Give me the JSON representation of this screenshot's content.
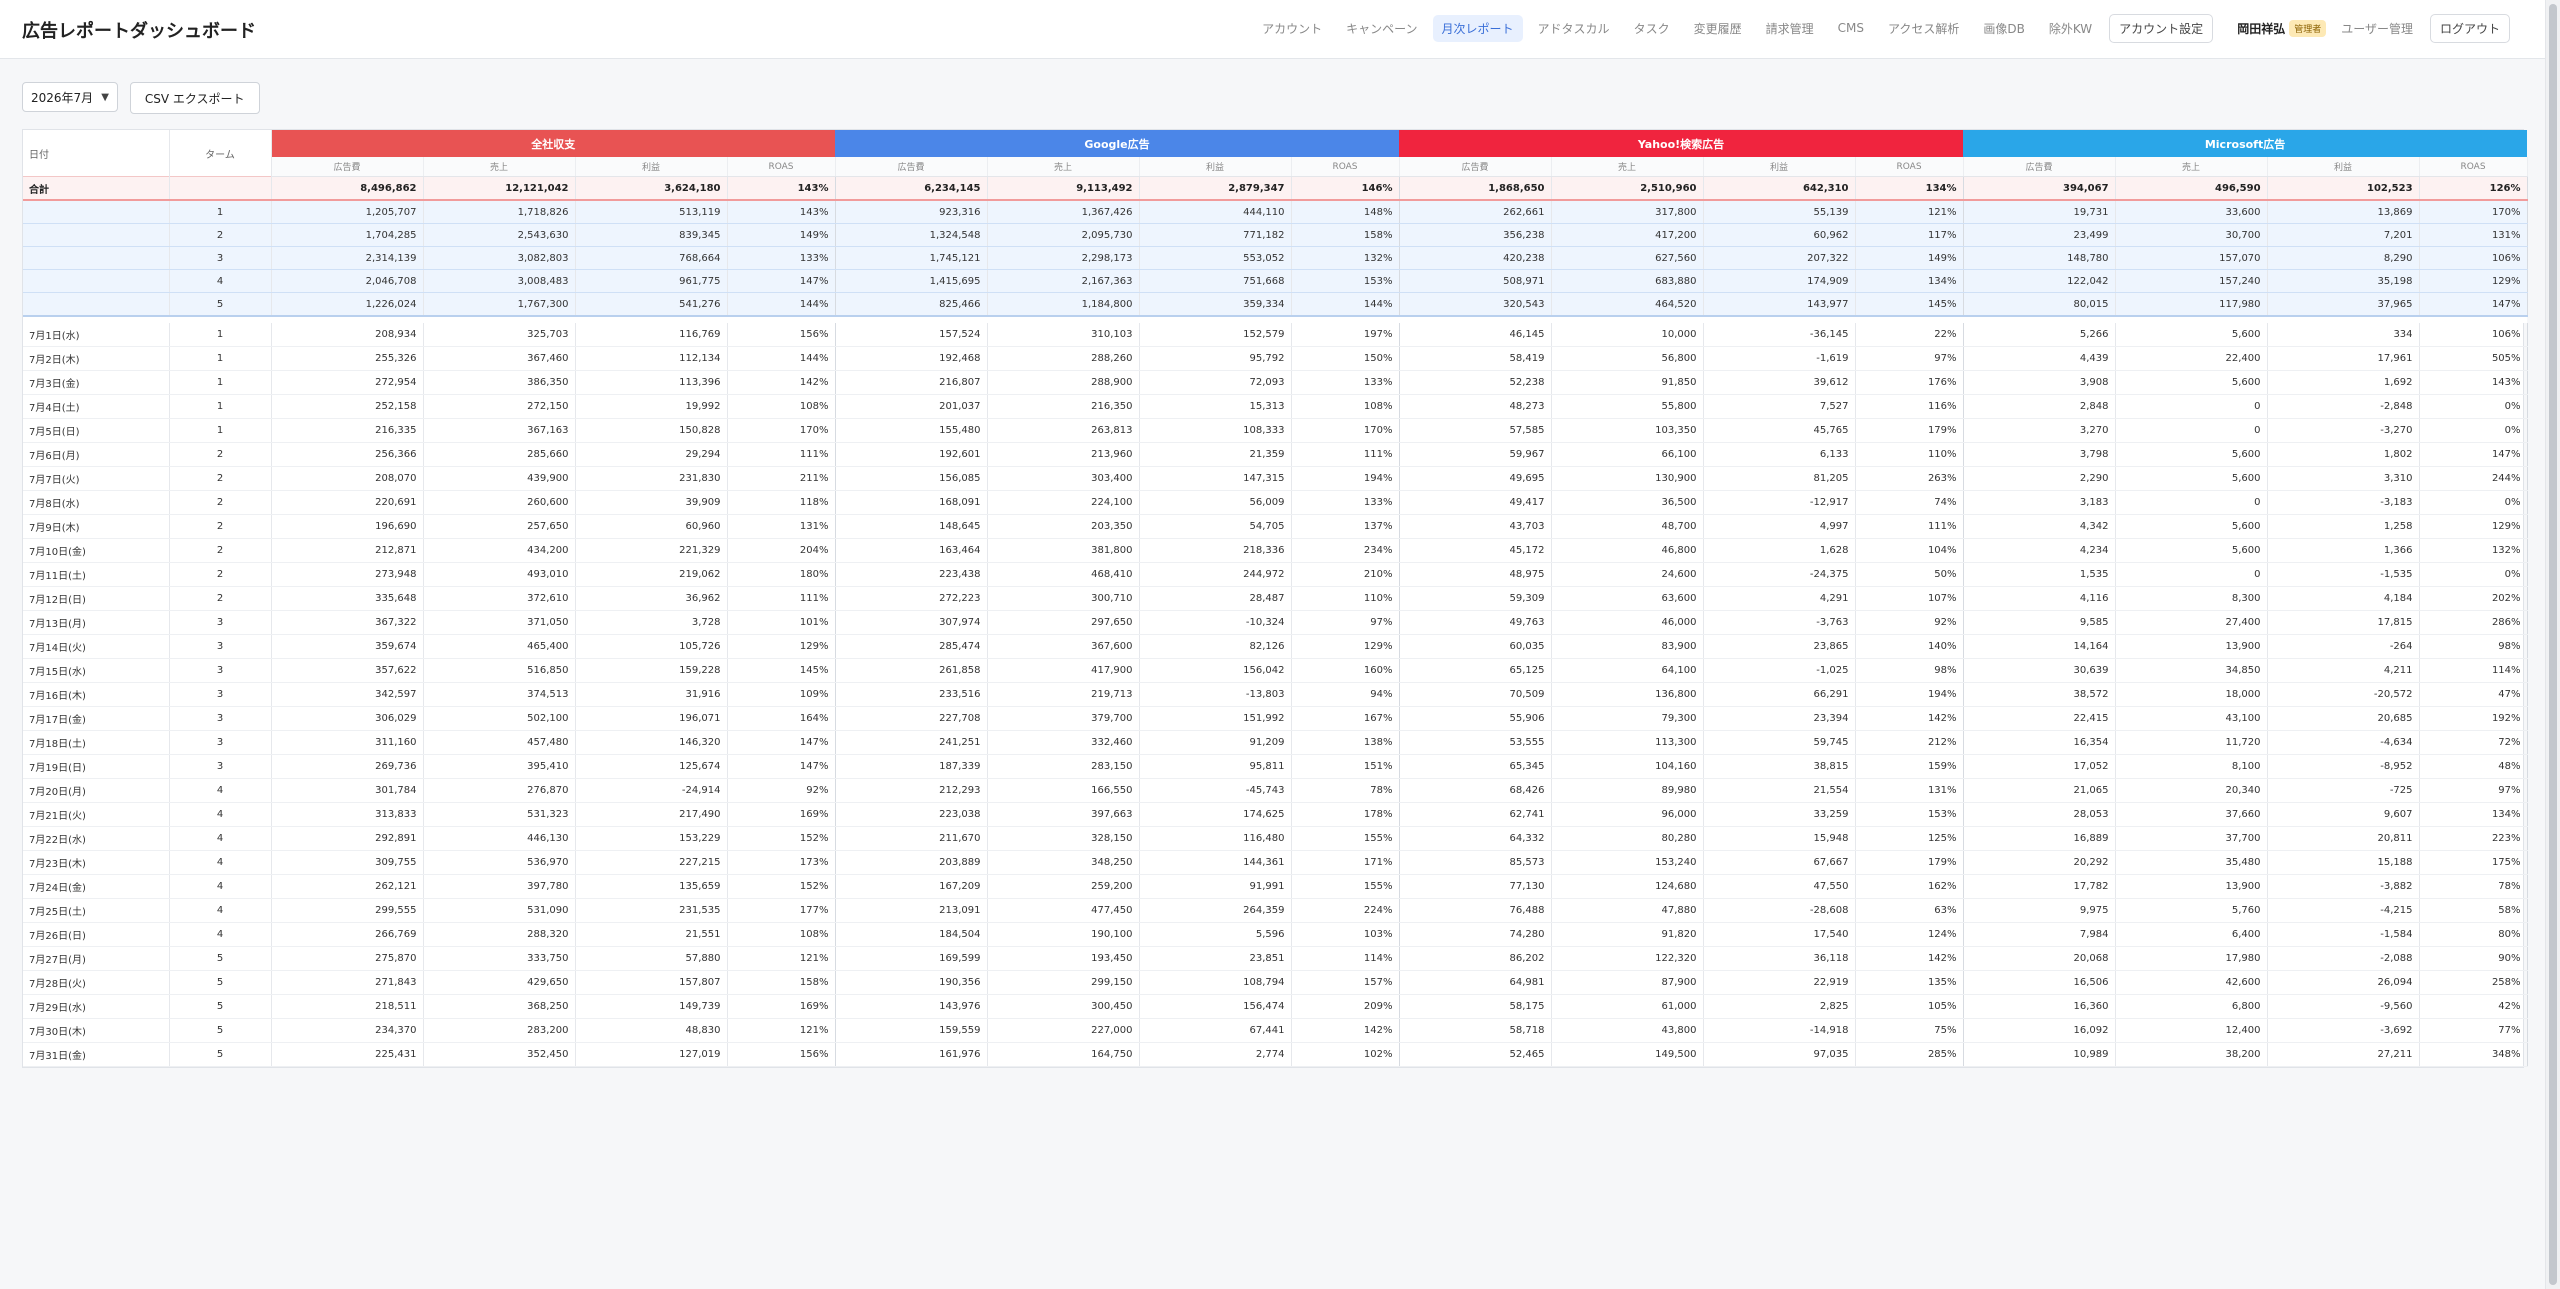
{
  "app": {
    "title": "広告レポートダッシュボード"
  },
  "nav": {
    "items": [
      "アカウント",
      "キャンペーン",
      "月次レポート",
      "アドタスカル",
      "タスク",
      "変更履歴",
      "請求管理",
      "CMS",
      "アクセス解析",
      "画像DB",
      "除外KW"
    ],
    "active": "月次レポート",
    "account_settings": "アカウント設定",
    "user_name": "岡田祥弘",
    "user_role": "管理者",
    "user_admin": "ユーザー管理",
    "logout": "ログアウト"
  },
  "toolbar": {
    "month": "2026年7月",
    "csv_label": "CSV エクスポート"
  },
  "table": {
    "date_header": "日付",
    "turn_header": "ターム",
    "groups": [
      "全社収支",
      "Google広告",
      "Yahoo!検索広告",
      "Microsoft広告"
    ],
    "metrics": [
      "広告費",
      "売上",
      "利益",
      "ROAS"
    ],
    "total": {
      "label": "合計",
      "cells": [
        "8,496,862",
        "12,121,042",
        "3,624,180",
        "143%",
        "6,234,145",
        "9,113,492",
        "2,879,347",
        "146%",
        "1,868,650",
        "2,510,960",
        "642,310",
        "134%",
        "394,067",
        "496,590",
        "102,523",
        "126%"
      ]
    },
    "turns": [
      {
        "turn": "1",
        "cells": [
          "1,205,707",
          "1,718,826",
          "513,119",
          "143%",
          "923,316",
          "1,367,426",
          "444,110",
          "148%",
          "262,661",
          "317,800",
          "55,139",
          "121%",
          "19,731",
          "33,600",
          "13,869",
          "170%"
        ]
      },
      {
        "turn": "2",
        "cells": [
          "1,704,285",
          "2,543,630",
          "839,345",
          "149%",
          "1,324,548",
          "2,095,730",
          "771,182",
          "158%",
          "356,238",
          "417,200",
          "60,962",
          "117%",
          "23,499",
          "30,700",
          "7,201",
          "131%"
        ]
      },
      {
        "turn": "3",
        "cells": [
          "2,314,139",
          "3,082,803",
          "768,664",
          "133%",
          "1,745,121",
          "2,298,173",
          "553,052",
          "132%",
          "420,238",
          "627,560",
          "207,322",
          "149%",
          "148,780",
          "157,070",
          "8,290",
          "106%"
        ]
      },
      {
        "turn": "4",
        "cells": [
          "2,046,708",
          "3,008,483",
          "961,775",
          "147%",
          "1,415,695",
          "2,167,363",
          "751,668",
          "153%",
          "508,971",
          "683,880",
          "174,909",
          "134%",
          "122,042",
          "157,240",
          "35,198",
          "129%"
        ]
      },
      {
        "turn": "5",
        "cells": [
          "1,226,024",
          "1,767,300",
          "541,276",
          "144%",
          "825,466",
          "1,184,800",
          "359,334",
          "144%",
          "320,543",
          "464,520",
          "143,977",
          "145%",
          "80,015",
          "117,980",
          "37,965",
          "147%"
        ]
      }
    ],
    "days": [
      {
        "date": "7月1日(水)",
        "wd": "",
        "turn": "1",
        "cells": [
          "208,934",
          "325,703",
          "116,769",
          "156%",
          "157,524",
          "310,103",
          "152,579",
          "197%",
          "46,145",
          "10,000",
          "-36,145",
          "22%",
          "5,266",
          "5,600",
          "334",
          "106%"
        ]
      },
      {
        "date": "7月2日(木)",
        "wd": "",
        "turn": "1",
        "cells": [
          "255,326",
          "367,460",
          "112,134",
          "144%",
          "192,468",
          "288,260",
          "95,792",
          "150%",
          "58,419",
          "56,800",
          "-1,619",
          "97%",
          "4,439",
          "22,400",
          "17,961",
          "505%"
        ]
      },
      {
        "date": "7月3日(金)",
        "wd": "",
        "turn": "1",
        "cells": [
          "272,954",
          "386,350",
          "113,396",
          "142%",
          "216,807",
          "288,900",
          "72,093",
          "133%",
          "52,238",
          "91,850",
          "39,612",
          "176%",
          "3,908",
          "5,600",
          "1,692",
          "143%"
        ]
      },
      {
        "date": "7月4日(土)",
        "wd": "sat",
        "turn": "1",
        "cells": [
          "252,158",
          "272,150",
          "19,992",
          "108%",
          "201,037",
          "216,350",
          "15,313",
          "108%",
          "48,273",
          "55,800",
          "7,527",
          "116%",
          "2,848",
          "0",
          "-2,848",
          "0%"
        ]
      },
      {
        "date": "7月5日(日)",
        "wd": "sun",
        "turn": "1",
        "cells": [
          "216,335",
          "367,163",
          "150,828",
          "170%",
          "155,480",
          "263,813",
          "108,333",
          "170%",
          "57,585",
          "103,350",
          "45,765",
          "179%",
          "3,270",
          "0",
          "-3,270",
          "0%"
        ]
      },
      {
        "date": "7月6日(月)",
        "wd": "",
        "turn": "2",
        "cells": [
          "256,366",
          "285,660",
          "29,294",
          "111%",
          "192,601",
          "213,960",
          "21,359",
          "111%",
          "59,967",
          "66,100",
          "6,133",
          "110%",
          "3,798",
          "5,600",
          "1,802",
          "147%"
        ]
      },
      {
        "date": "7月7日(火)",
        "wd": "",
        "turn": "2",
        "cells": [
          "208,070",
          "439,900",
          "231,830",
          "211%",
          "156,085",
          "303,400",
          "147,315",
          "194%",
          "49,695",
          "130,900",
          "81,205",
          "263%",
          "2,290",
          "5,600",
          "3,310",
          "244%"
        ]
      },
      {
        "date": "7月8日(水)",
        "wd": "",
        "turn": "2",
        "cells": [
          "220,691",
          "260,600",
          "39,909",
          "118%",
          "168,091",
          "224,100",
          "56,009",
          "133%",
          "49,417",
          "36,500",
          "-12,917",
          "74%",
          "3,183",
          "0",
          "-3,183",
          "0%"
        ]
      },
      {
        "date": "7月9日(木)",
        "wd": "",
        "turn": "2",
        "cells": [
          "196,690",
          "257,650",
          "60,960",
          "131%",
          "148,645",
          "203,350",
          "54,705",
          "137%",
          "43,703",
          "48,700",
          "4,997",
          "111%",
          "4,342",
          "5,600",
          "1,258",
          "129%"
        ]
      },
      {
        "date": "7月10日(金)",
        "wd": "",
        "turn": "2",
        "cells": [
          "212,871",
          "434,200",
          "221,329",
          "204%",
          "163,464",
          "381,800",
          "218,336",
          "234%",
          "45,172",
          "46,800",
          "1,628",
          "104%",
          "4,234",
          "5,600",
          "1,366",
          "132%"
        ]
      },
      {
        "date": "7月11日(土)",
        "wd": "sat",
        "turn": "2",
        "cells": [
          "273,948",
          "493,010",
          "219,062",
          "180%",
          "223,438",
          "468,410",
          "244,972",
          "210%",
          "48,975",
          "24,600",
          "-24,375",
          "50%",
          "1,535",
          "0",
          "-1,535",
          "0%"
        ]
      },
      {
        "date": "7月12日(日)",
        "wd": "sun",
        "turn": "2",
        "cells": [
          "335,648",
          "372,610",
          "36,962",
          "111%",
          "272,223",
          "300,710",
          "28,487",
          "110%",
          "59,309",
          "63,600",
          "4,291",
          "107%",
          "4,116",
          "8,300",
          "4,184",
          "202%"
        ]
      },
      {
        "date": "7月13日(月)",
        "wd": "",
        "turn": "3",
        "cells": [
          "367,322",
          "371,050",
          "3,728",
          "101%",
          "307,974",
          "297,650",
          "-10,324",
          "97%",
          "49,763",
          "46,000",
          "-3,763",
          "92%",
          "9,585",
          "27,400",
          "17,815",
          "286%"
        ]
      },
      {
        "date": "7月14日(火)",
        "wd": "",
        "turn": "3",
        "cells": [
          "359,674",
          "465,400",
          "105,726",
          "129%",
          "285,474",
          "367,600",
          "82,126",
          "129%",
          "60,035",
          "83,900",
          "23,865",
          "140%",
          "14,164",
          "13,900",
          "-264",
          "98%"
        ]
      },
      {
        "date": "7月15日(水)",
        "wd": "",
        "turn": "3",
        "cells": [
          "357,622",
          "516,850",
          "159,228",
          "145%",
          "261,858",
          "417,900",
          "156,042",
          "160%",
          "65,125",
          "64,100",
          "-1,025",
          "98%",
          "30,639",
          "34,850",
          "4,211",
          "114%"
        ]
      },
      {
        "date": "7月16日(木)",
        "wd": "",
        "turn": "3",
        "cells": [
          "342,597",
          "374,513",
          "31,916",
          "109%",
          "233,516",
          "219,713",
          "-13,803",
          "94%",
          "70,509",
          "136,800",
          "66,291",
          "194%",
          "38,572",
          "18,000",
          "-20,572",
          "47%"
        ]
      },
      {
        "date": "7月17日(金)",
        "wd": "",
        "turn": "3",
        "cells": [
          "306,029",
          "502,100",
          "196,071",
          "164%",
          "227,708",
          "379,700",
          "151,992",
          "167%",
          "55,906",
          "79,300",
          "23,394",
          "142%",
          "22,415",
          "43,100",
          "20,685",
          "192%"
        ]
      },
      {
        "date": "7月18日(土)",
        "wd": "sat",
        "turn": "3",
        "cells": [
          "311,160",
          "457,480",
          "146,320",
          "147%",
          "241,251",
          "332,460",
          "91,209",
          "138%",
          "53,555",
          "113,300",
          "59,745",
          "212%",
          "16,354",
          "11,720",
          "-4,634",
          "72%"
        ]
      },
      {
        "date": "7月19日(日)",
        "wd": "sun",
        "turn": "3",
        "cells": [
          "269,736",
          "395,410",
          "125,674",
          "147%",
          "187,339",
          "283,150",
          "95,811",
          "151%",
          "65,345",
          "104,160",
          "38,815",
          "159%",
          "17,052",
          "8,100",
          "-8,952",
          "48%"
        ]
      },
      {
        "date": "7月20日(月)",
        "wd": "sun",
        "turn": "4",
        "cells": [
          "301,784",
          "276,870",
          "-24,914",
          "92%",
          "212,293",
          "166,550",
          "-45,743",
          "78%",
          "68,426",
          "89,980",
          "21,554",
          "131%",
          "21,065",
          "20,340",
          "-725",
          "97%"
        ]
      },
      {
        "date": "7月21日(火)",
        "wd": "",
        "turn": "4",
        "cells": [
          "313,833",
          "531,323",
          "217,490",
          "169%",
          "223,038",
          "397,663",
          "174,625",
          "178%",
          "62,741",
          "96,000",
          "33,259",
          "153%",
          "28,053",
          "37,660",
          "9,607",
          "134%"
        ]
      },
      {
        "date": "7月22日(水)",
        "wd": "",
        "turn": "4",
        "cells": [
          "292,891",
          "446,130",
          "153,229",
          "152%",
          "211,670",
          "328,150",
          "116,480",
          "155%",
          "64,332",
          "80,280",
          "15,948",
          "125%",
          "16,889",
          "37,700",
          "20,811",
          "223%"
        ]
      },
      {
        "date": "7月23日(木)",
        "wd": "",
        "turn": "4",
        "cells": [
          "309,755",
          "536,970",
          "227,215",
          "173%",
          "203,889",
          "348,250",
          "144,361",
          "171%",
          "85,573",
          "153,240",
          "67,667",
          "179%",
          "20,292",
          "35,480",
          "15,188",
          "175%"
        ]
      },
      {
        "date": "7月24日(金)",
        "wd": "",
        "turn": "4",
        "cells": [
          "262,121",
          "397,780",
          "135,659",
          "152%",
          "167,209",
          "259,200",
          "91,991",
          "155%",
          "77,130",
          "124,680",
          "47,550",
          "162%",
          "17,782",
          "13,900",
          "-3,882",
          "78%"
        ]
      },
      {
        "date": "7月25日(土)",
        "wd": "sat",
        "turn": "4",
        "cells": [
          "299,555",
          "531,090",
          "231,535",
          "177%",
          "213,091",
          "477,450",
          "264,359",
          "224%",
          "76,488",
          "47,880",
          "-28,608",
          "63%",
          "9,975",
          "5,760",
          "-4,215",
          "58%"
        ]
      },
      {
        "date": "7月26日(日)",
        "wd": "sun",
        "turn": "4",
        "cells": [
          "266,769",
          "288,320",
          "21,551",
          "108%",
          "184,504",
          "190,100",
          "5,596",
          "103%",
          "74,280",
          "91,820",
          "17,540",
          "124%",
          "7,984",
          "6,400",
          "-1,584",
          "80%"
        ]
      },
      {
        "date": "7月27日(月)",
        "wd": "",
        "turn": "5",
        "cells": [
          "275,870",
          "333,750",
          "57,880",
          "121%",
          "169,599",
          "193,450",
          "23,851",
          "114%",
          "86,202",
          "122,320",
          "36,118",
          "142%",
          "20,068",
          "17,980",
          "-2,088",
          "90%"
        ]
      },
      {
        "date": "7月28日(火)",
        "wd": "",
        "turn": "5",
        "cells": [
          "271,843",
          "429,650",
          "157,807",
          "158%",
          "190,356",
          "299,150",
          "108,794",
          "157%",
          "64,981",
          "87,900",
          "22,919",
          "135%",
          "16,506",
          "42,600",
          "26,094",
          "258%"
        ]
      },
      {
        "date": "7月29日(水)",
        "wd": "",
        "turn": "5",
        "cells": [
          "218,511",
          "368,250",
          "149,739",
          "169%",
          "143,976",
          "300,450",
          "156,474",
          "209%",
          "58,175",
          "61,000",
          "2,825",
          "105%",
          "16,360",
          "6,800",
          "-9,560",
          "42%"
        ]
      },
      {
        "date": "7月30日(木)",
        "wd": "",
        "turn": "5",
        "cells": [
          "234,370",
          "283,200",
          "48,830",
          "121%",
          "159,559",
          "227,000",
          "67,441",
          "142%",
          "58,718",
          "43,800",
          "-14,918",
          "75%",
          "16,092",
          "12,400",
          "-3,692",
          "77%"
        ]
      },
      {
        "date": "7月31日(金)",
        "wd": "",
        "turn": "5",
        "cells": [
          "225,431",
          "352,450",
          "127,019",
          "156%",
          "161,976",
          "164,750",
          "2,774",
          "102%",
          "52,465",
          "149,500",
          "97,035",
          "285%",
          "10,989",
          "38,200",
          "27,211",
          "348%"
        ]
      }
    ]
  }
}
